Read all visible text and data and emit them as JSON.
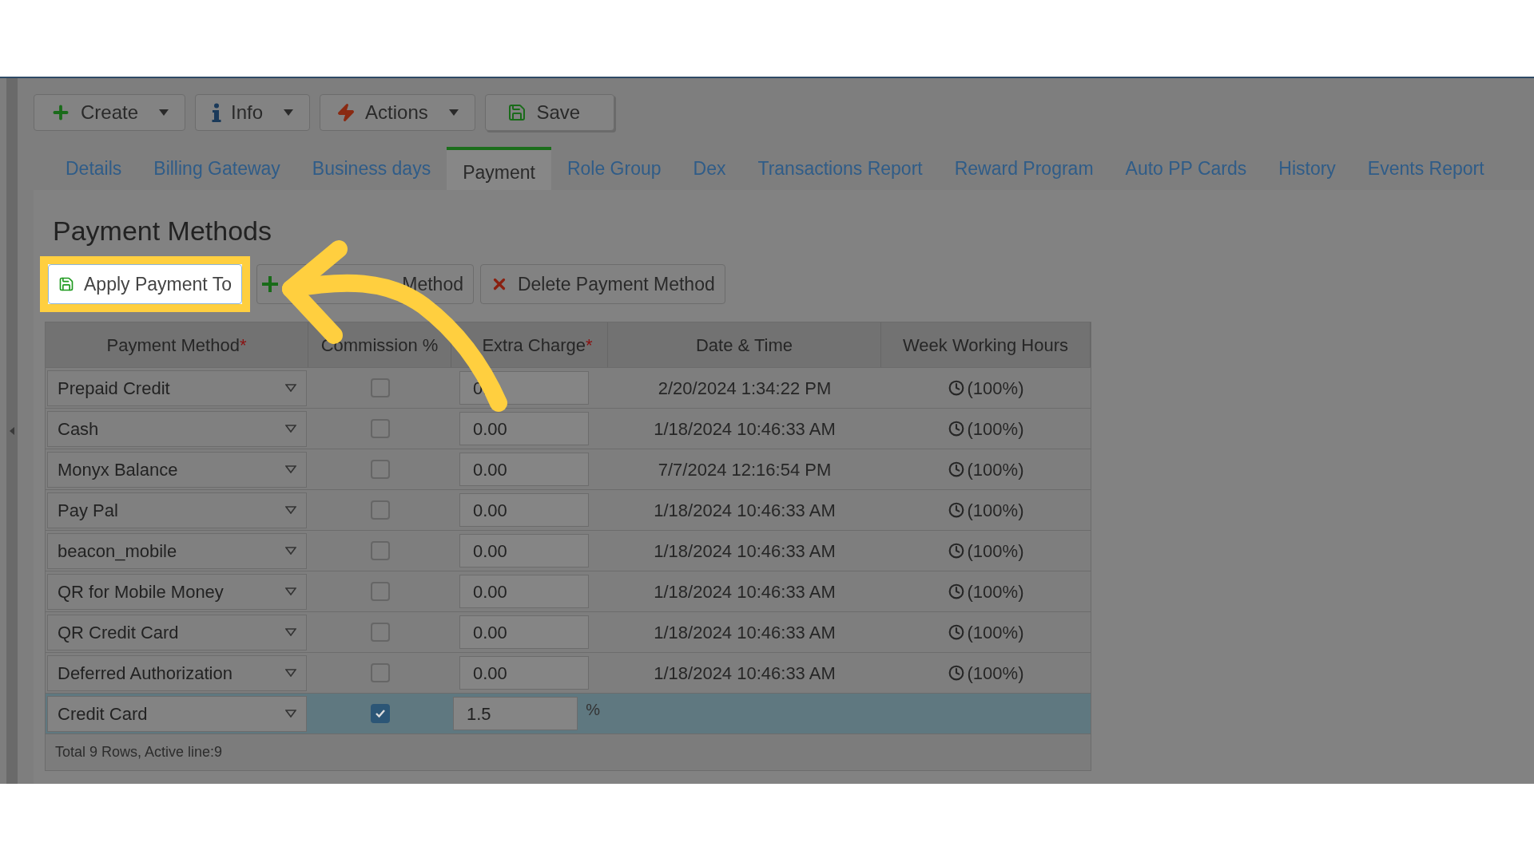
{
  "toolbar": [
    {
      "label": "Create",
      "kind": "create",
      "dropdown": true
    },
    {
      "label": "Info",
      "kind": "info",
      "dropdown": true
    },
    {
      "label": "Actions",
      "kind": "actions",
      "dropdown": true
    },
    {
      "label": "Save",
      "kind": "save",
      "dropdown": false
    }
  ],
  "tabs": [
    {
      "label": "Details",
      "selected": false
    },
    {
      "label": "Billing Gateway",
      "selected": false
    },
    {
      "label": "Business days",
      "selected": false
    },
    {
      "label": "Payment",
      "selected": true
    },
    {
      "label": "Role Group",
      "selected": false
    },
    {
      "label": "Dex",
      "selected": false
    },
    {
      "label": "Transactions Report",
      "selected": false
    },
    {
      "label": "Reward Program",
      "selected": false
    },
    {
      "label": "Auto PP Cards",
      "selected": false
    },
    {
      "label": "History",
      "selected": false
    },
    {
      "label": "Events Report",
      "selected": false
    }
  ],
  "title": "Payment Methods",
  "actions": [
    {
      "label": "Apply Payment To",
      "kind": "apply",
      "highlighted": true
    },
    {
      "label": "Method",
      "kind": "add",
      "highlighted": false
    },
    {
      "label": "Delete Payment Method",
      "kind": "delete",
      "highlighted": false
    }
  ],
  "table": {
    "columns": [
      {
        "label": "Payment Method",
        "mark": "*"
      },
      {
        "label": "Commission %"
      },
      {
        "label": "Extra Charge",
        "mark": "*"
      },
      {
        "label": "Date & Time"
      },
      {
        "label": "Week Working Hours"
      }
    ],
    "rows": [
      {
        "method": "Prepaid Credit",
        "commission": false,
        "extra_charge": "0.",
        "date": "2/20/2024 1:34:22 PM",
        "hours": "(100%)",
        "selected": false
      },
      {
        "method": "Cash",
        "commission": false,
        "extra_charge": "0.00",
        "date": "1/18/2024 10:46:33 AM",
        "hours": "(100%)",
        "selected": false
      },
      {
        "method": "Monyx Balance",
        "commission": false,
        "extra_charge": "0.00",
        "date": "7/7/2024 12:16:54 PM",
        "hours": "(100%)",
        "selected": false
      },
      {
        "method": "Pay Pal",
        "commission": false,
        "extra_charge": "0.00",
        "date": "1/18/2024 10:46:33 AM",
        "hours": "(100%)",
        "selected": false
      },
      {
        "method": "beacon_mobile",
        "commission": false,
        "extra_charge": "0.00",
        "date": "1/18/2024 10:46:33 AM",
        "hours": "(100%)",
        "selected": false
      },
      {
        "method": "QR for Mobile Money",
        "commission": false,
        "extra_charge": "0.00",
        "date": "1/18/2024 10:46:33 AM",
        "hours": "(100%)",
        "selected": false
      },
      {
        "method": "QR Credit Card",
        "commission": false,
        "extra_charge": "0.00",
        "date": "1/18/2024 10:46:33 AM",
        "hours": "(100%)",
        "selected": false
      },
      {
        "method": "Deferred Authorization",
        "commission": false,
        "extra_charge": "0.00",
        "date": "1/18/2024 10:46:33 AM",
        "hours": "(100%)",
        "selected": false
      },
      {
        "method": "Credit Card",
        "commission": true,
        "extra_charge": "1.5",
        "unit": "%",
        "selected": true
      }
    ],
    "footer": "Total 9 Rows, Active line:9"
  }
}
